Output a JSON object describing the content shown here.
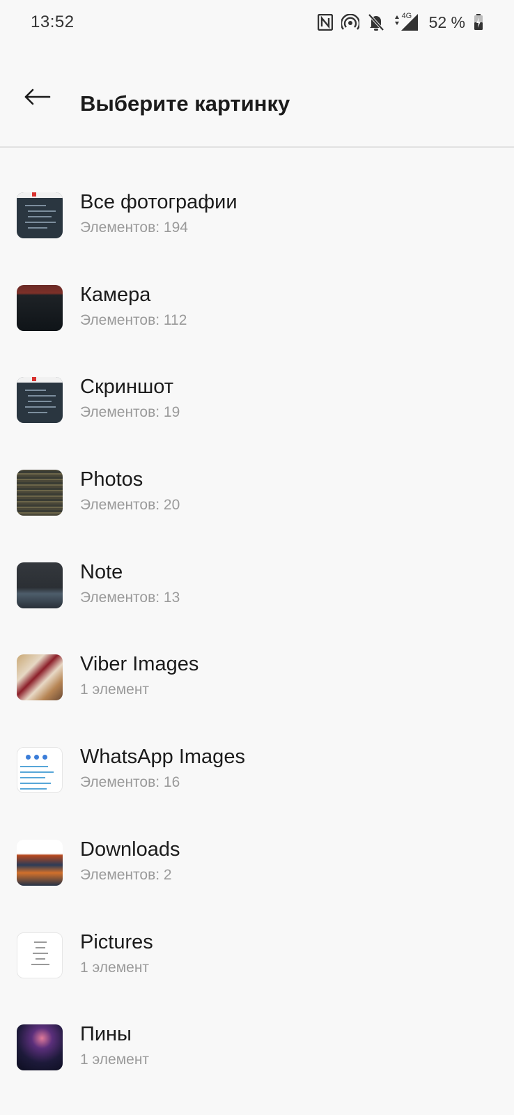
{
  "status_bar": {
    "time": "13:52",
    "icons": [
      "nfc-icon",
      "hotspot-icon",
      "bell-off-icon",
      "signal-4g-icon"
    ],
    "network_label": "4G",
    "battery_percent": "52 %",
    "battery_charging": true
  },
  "app_bar": {
    "back_icon": "arrow-left-icon",
    "title": "Выберите картинку"
  },
  "albums": [
    {
      "name": "Все фотографии",
      "count": "Элементов: 194",
      "thumb": "code-screenshot"
    },
    {
      "name": "Камера",
      "count": "Элементов: 112",
      "thumb": "camera-photo"
    },
    {
      "name": "Скриншот",
      "count": "Элементов: 19",
      "thumb": "code-screenshot"
    },
    {
      "name": "Photos",
      "count": "Элементов: 20",
      "thumb": "monitor-photo"
    },
    {
      "name": "Note",
      "count": "Элементов: 13",
      "thumb": "dark-photo"
    },
    {
      "name": "Viber Images",
      "count": "1 элемент",
      "thumb": "food-photo"
    },
    {
      "name": "WhatsApp Images",
      "count": "Элементов: 16",
      "thumb": "chat-screenshot"
    },
    {
      "name": "Downloads",
      "count": "Элементов: 2",
      "thumb": "city-poster"
    },
    {
      "name": "Pictures",
      "count": "1 элемент",
      "thumb": "text-document"
    },
    {
      "name": "Пины",
      "count": "1 элемент",
      "thumb": "neon-art"
    }
  ],
  "colors": {
    "background": "#f8f8f8",
    "primary_text": "#1b1b1b",
    "secondary_text": "#9a9a9a",
    "divider": "#e2e2e2"
  }
}
